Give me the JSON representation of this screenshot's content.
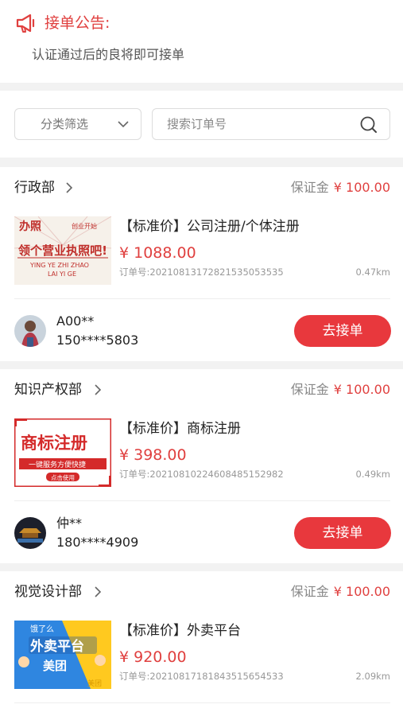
{
  "notice": {
    "title": "接单公告:",
    "text": "认证通过后的良将即可接单"
  },
  "filter": {
    "category_label": "分类筛选",
    "search_placeholder": "搜索订单号"
  },
  "colors": {
    "accent": "#e0403f",
    "button": "#e8383d"
  },
  "orders": [
    {
      "department": "行政部",
      "deposit_label": "保证金",
      "deposit_amount": "¥ 100.00",
      "title": "【标准价】公司注册/个体注册",
      "price": "¥ 1088.00",
      "order_no": "订单号:20210813172821535053535",
      "distance": "0.47km",
      "thumb": {
        "line1": "办照",
        "line1b": "创业开始",
        "line2": "领个营业执照吧!",
        "line3": "YING YE ZHI ZHAO",
        "line4": "LAI YI GE"
      },
      "user": {
        "name": "A00**",
        "phone": "150****5803"
      },
      "action_label": "去接单"
    },
    {
      "department": "知识产权部",
      "deposit_label": "保证金",
      "deposit_amount": "¥ 100.00",
      "title": "【标准价】商标注册",
      "price": "¥ 398.00",
      "order_no": "订单号:20210810224608485152982",
      "distance": "0.49km",
      "thumb": {
        "line1": "商标注册",
        "line2": "一键服务方便快捷",
        "line3": "点击使用"
      },
      "user": {
        "name": "仲**",
        "phone": "180****4909"
      },
      "action_label": "去接单"
    },
    {
      "department": "视觉设计部",
      "deposit_label": "保证金",
      "deposit_amount": "¥ 100.00",
      "title": "【标准价】外卖平台",
      "price": "¥ 920.00",
      "order_no": "订单号:20210817181843515654533",
      "distance": "2.09km",
      "thumb": {
        "line1": "饿了么",
        "line2": "外卖平台",
        "line3": "美团",
        "line4": "美团"
      }
    }
  ]
}
